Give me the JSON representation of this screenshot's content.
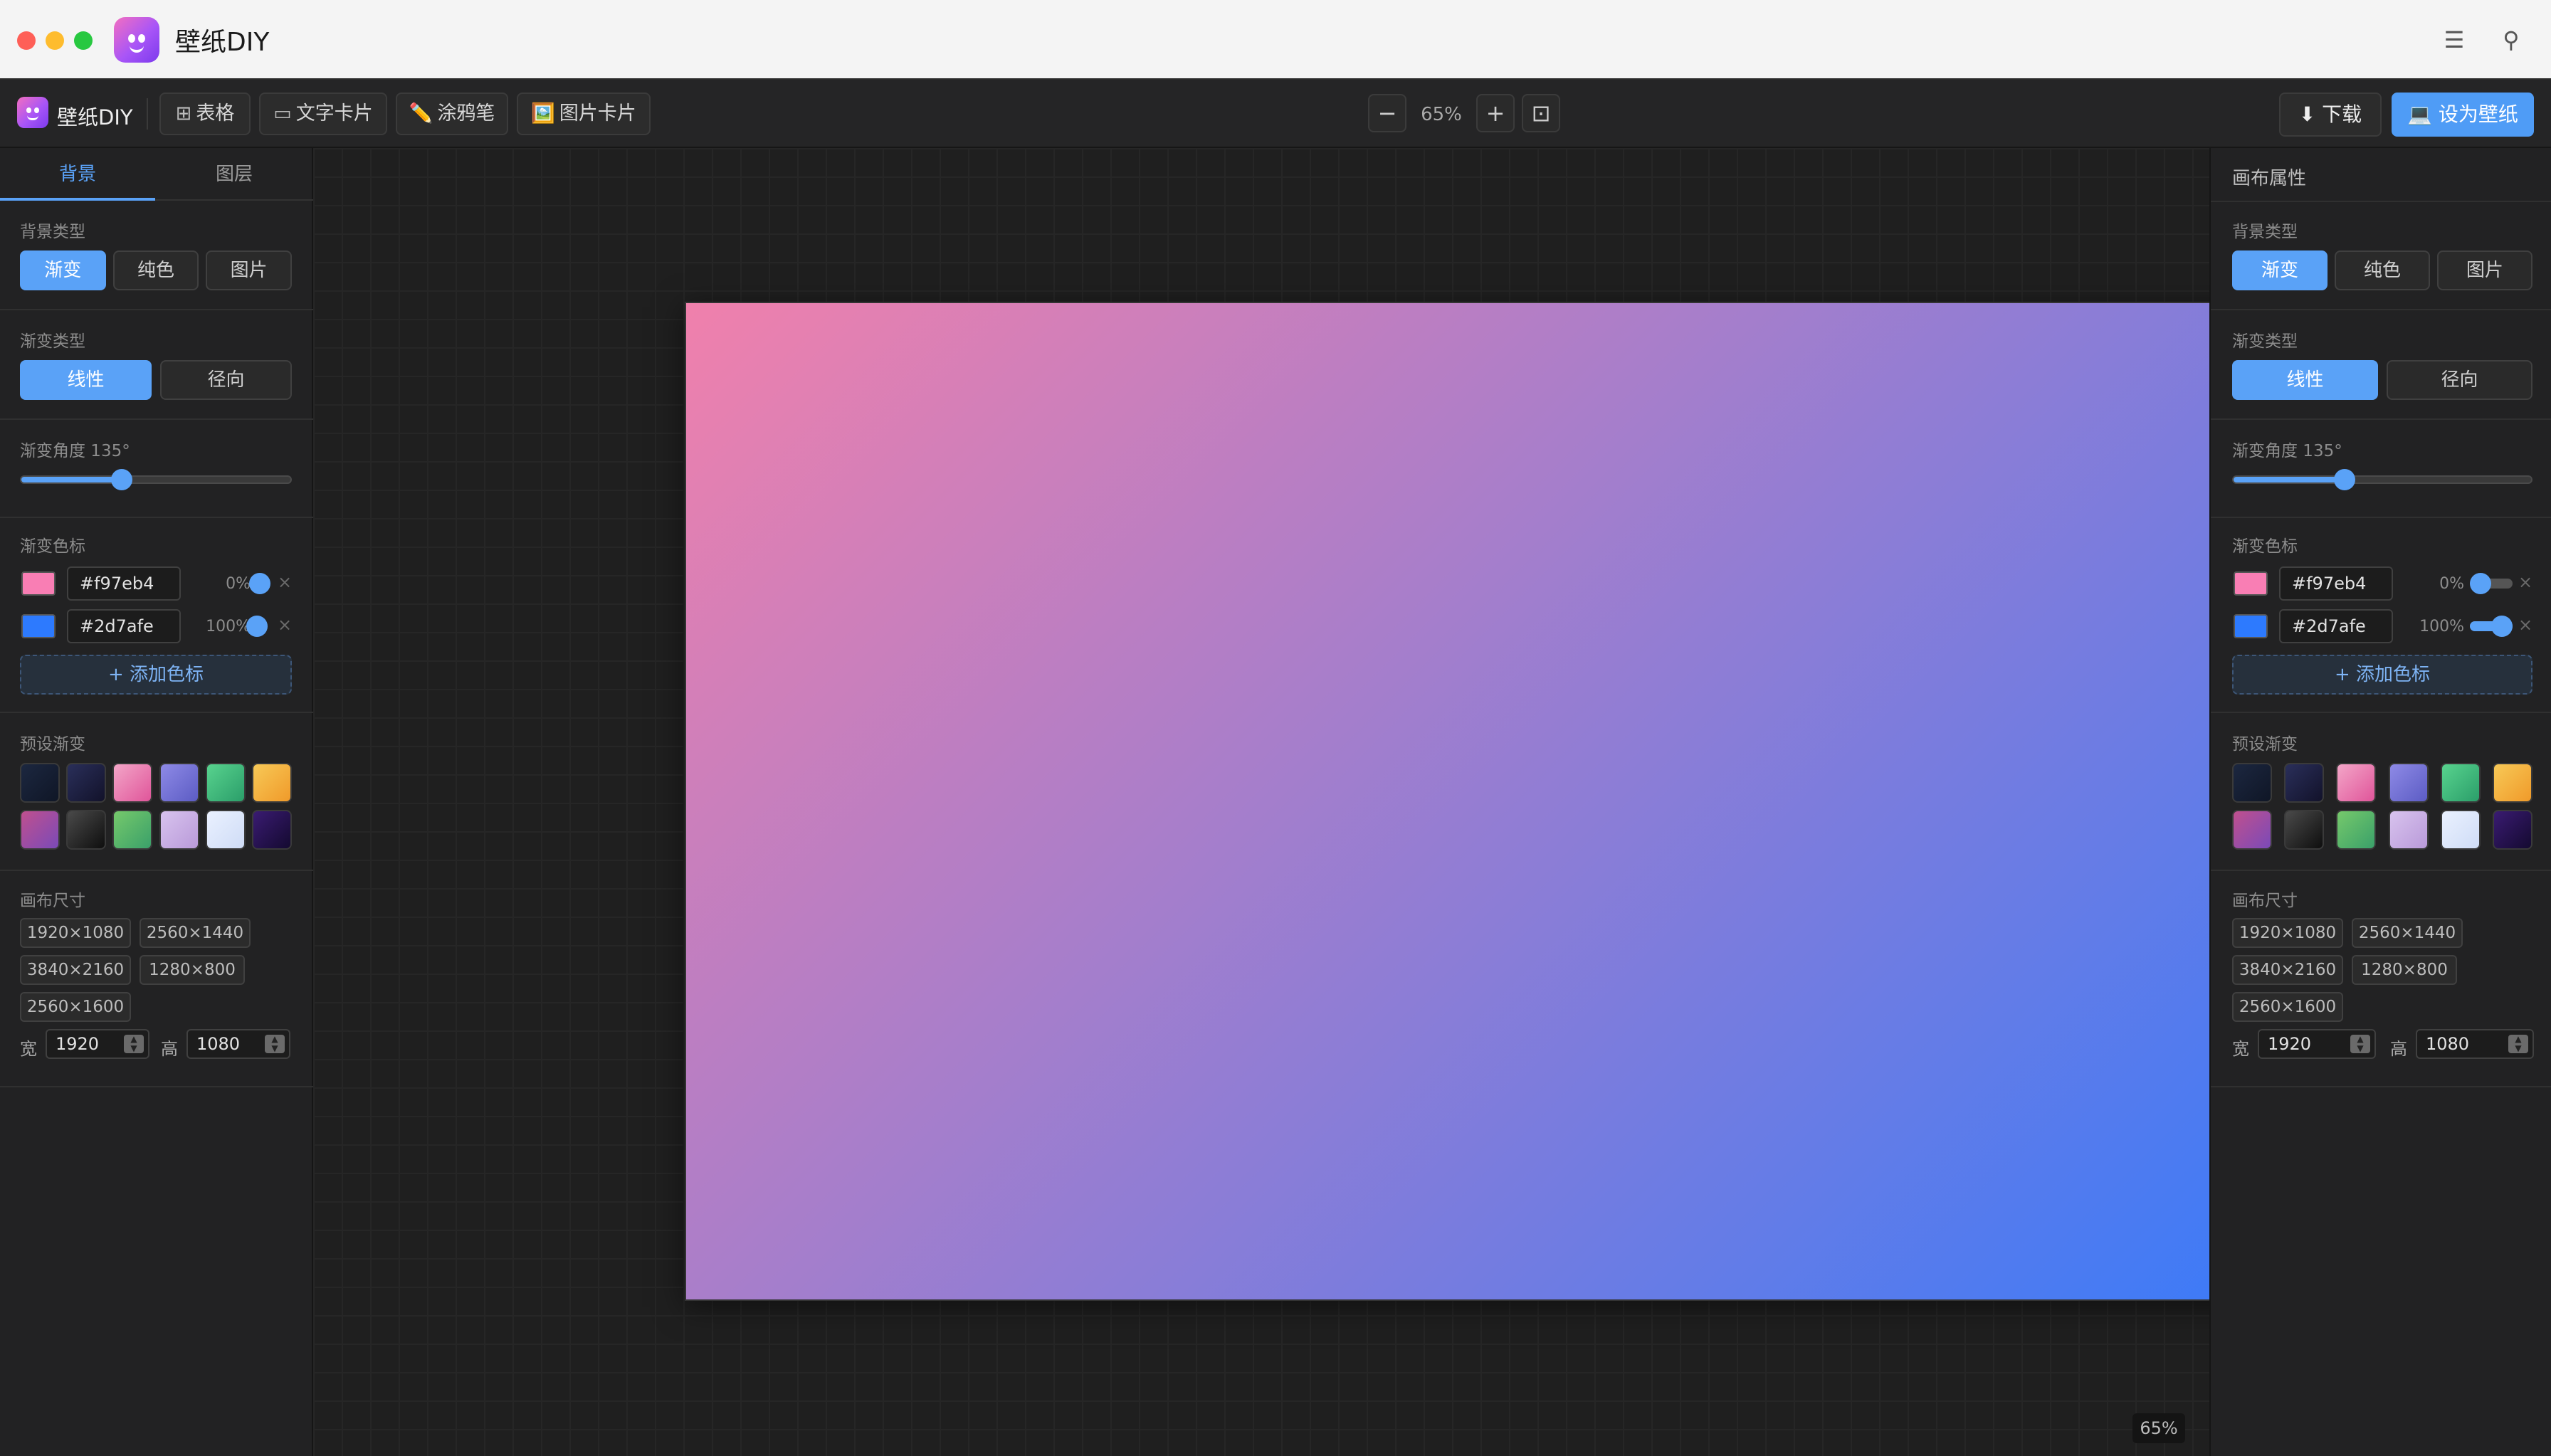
{
  "window": {
    "title": "壁纸DIY"
  },
  "toolbar": {
    "app_name": "壁纸DIY",
    "tools": [
      {
        "icon": "grid-icon",
        "glyph": "⊞",
        "label": "表格"
      },
      {
        "icon": "text-card-icon",
        "glyph": "▭",
        "label": "文字卡片"
      },
      {
        "icon": "pencil-icon",
        "glyph": "✏️",
        "label": "涂鸦笔"
      },
      {
        "icon": "image-icon",
        "glyph": "🖼️",
        "label": "图片卡片"
      }
    ],
    "zoom": {
      "minus": "−",
      "value": "65%",
      "plus": "+",
      "fit": "⊡"
    },
    "download": {
      "glyph": "⬇",
      "label": "下载"
    },
    "set_wallpaper": {
      "glyph": "💻",
      "label": "设为壁纸"
    }
  },
  "left_panel": {
    "tabs": [
      {
        "label": "背景",
        "active": true
      },
      {
        "label": "图层",
        "active": false
      }
    ]
  },
  "right_panel": {
    "title": "画布属性"
  },
  "background": {
    "type_label": "背景类型",
    "types": [
      "渐变",
      "纯色",
      "图片"
    ],
    "active_type": "渐变",
    "gradient_type_label": "渐变类型",
    "gradient_types": [
      "线性",
      "径向"
    ],
    "active_gradient_type": "线性",
    "angle_label": "渐变角度 135°",
    "angle_value_deg": 135,
    "stops_label": "渐变色标",
    "stops": [
      {
        "color": "#f97eb4",
        "hex": "#f97eb4",
        "percent": "0%"
      },
      {
        "color": "#2d7afe",
        "hex": "#2d7afe",
        "percent": "100%"
      }
    ],
    "remove_glyph": "×",
    "add_stop_label": "+ 添加色标",
    "presets_label": "预设渐变",
    "presets": [
      "linear-gradient(135deg,#1c2740,#0f1626)",
      "linear-gradient(135deg,#2a2f5a,#12122a)",
      "linear-gradient(135deg,#f3a6c8,#e0559a)",
      "linear-gradient(135deg,#8e8ae6,#5c5cc4)",
      "linear-gradient(135deg,#58d38e,#2b9e6a)",
      "linear-gradient(135deg,#f7c957,#f09a2a)",
      "linear-gradient(135deg,#c0508e,#7a4ab8)",
      "linear-gradient(135deg,#4a4a4a,#0e0e0e)",
      "linear-gradient(135deg,#76c96b,#3aa06a)",
      "linear-gradient(135deg,#d8c3ee,#b99ad9)",
      "linear-gradient(135deg,#eaf1ff,#cfdcf6)",
      "linear-gradient(135deg,#3a1b72,#140a30)"
    ],
    "size_label": "画布尺寸",
    "sizes": [
      "1920×1080",
      "2560×1440",
      "3840×2160",
      "1280×800",
      "2560×1600"
    ],
    "width_label": "宽",
    "width_value": "1920",
    "height_label": "高",
    "height_value": "1080"
  },
  "canvas": {
    "gradient": "linear-gradient(135deg, #f080ac 0%, #2d7afe 100%)",
    "zoom_badge": "65%"
  }
}
